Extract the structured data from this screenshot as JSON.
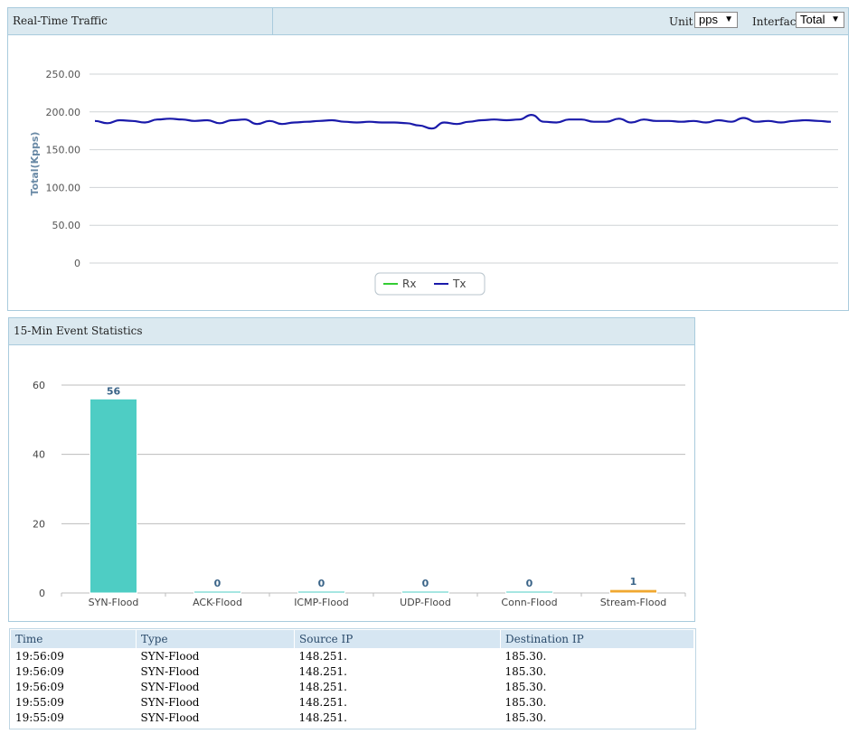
{
  "traffic_panel": {
    "title": "Real-Time Traffic",
    "unit_label": "Unit",
    "unit_value": "pps",
    "interface_label": "Interface",
    "interface_value": "Total",
    "dropdown_arrow": "▼"
  },
  "traffic_chart": {
    "type": "line",
    "ylabel": "Total(Kpps)",
    "yticks": [
      "250.00",
      "200.00",
      "150.00",
      "100.00",
      "50.00",
      "0"
    ],
    "ylim": [
      0,
      250
    ],
    "grid": true,
    "legend_placement": "bottom-center",
    "series": [
      {
        "name": "Rx",
        "color": "#33cc33",
        "values": []
      },
      {
        "name": "Tx",
        "color": "#1a1aaa",
        "values": [
          188,
          185,
          189,
          188,
          186,
          190,
          191,
          190,
          188,
          189,
          185,
          189,
          190,
          184,
          188,
          184,
          186,
          187,
          188,
          189,
          187,
          186,
          187,
          186,
          186,
          185,
          182,
          178,
          186,
          184,
          187,
          189,
          190,
          189,
          190,
          196,
          187,
          186,
          190,
          190,
          187,
          187,
          191,
          186,
          190,
          188,
          188,
          187,
          188,
          186,
          189,
          187,
          192,
          187,
          188,
          186,
          188,
          189,
          188,
          187
        ]
      }
    ]
  },
  "events_panel": {
    "title": "15-Min Event Statistics"
  },
  "chart_data": {
    "type": "bar",
    "categories": [
      "SYN-Flood",
      "ACK-Flood",
      "ICMP-Flood",
      "UDP-Flood",
      "Conn-Flood",
      "Stream-Flood"
    ],
    "values": [
      56,
      0,
      0,
      0,
      0,
      1
    ],
    "value_labels": [
      "56",
      "0",
      "0",
      "0",
      "0",
      "1"
    ],
    "colors": [
      "#4ecdc4",
      "#4ecdc4",
      "#4ecdc4",
      "#4ecdc4",
      "#4ecdc4",
      "#f0a830"
    ],
    "yticks": [
      "60",
      "40",
      "20",
      "0"
    ],
    "ylim": [
      0,
      60
    ],
    "grid": true,
    "xlabel": "",
    "ylabel": ""
  },
  "events_table": {
    "headers": [
      "Time",
      "Type",
      "Source IP",
      "Destination IP"
    ],
    "rows": [
      [
        "19:56:09",
        "SYN-Flood",
        "148.251.",
        "185.30."
      ],
      [
        "19:56:09",
        "SYN-Flood",
        "148.251.",
        "185.30."
      ],
      [
        "19:56:09",
        "SYN-Flood",
        "148.251.",
        "185.30."
      ],
      [
        "19:55:09",
        "SYN-Flood",
        "148.251.",
        "185.30."
      ],
      [
        "19:55:09",
        "SYN-Flood",
        "148.251.",
        "185.30."
      ]
    ]
  }
}
